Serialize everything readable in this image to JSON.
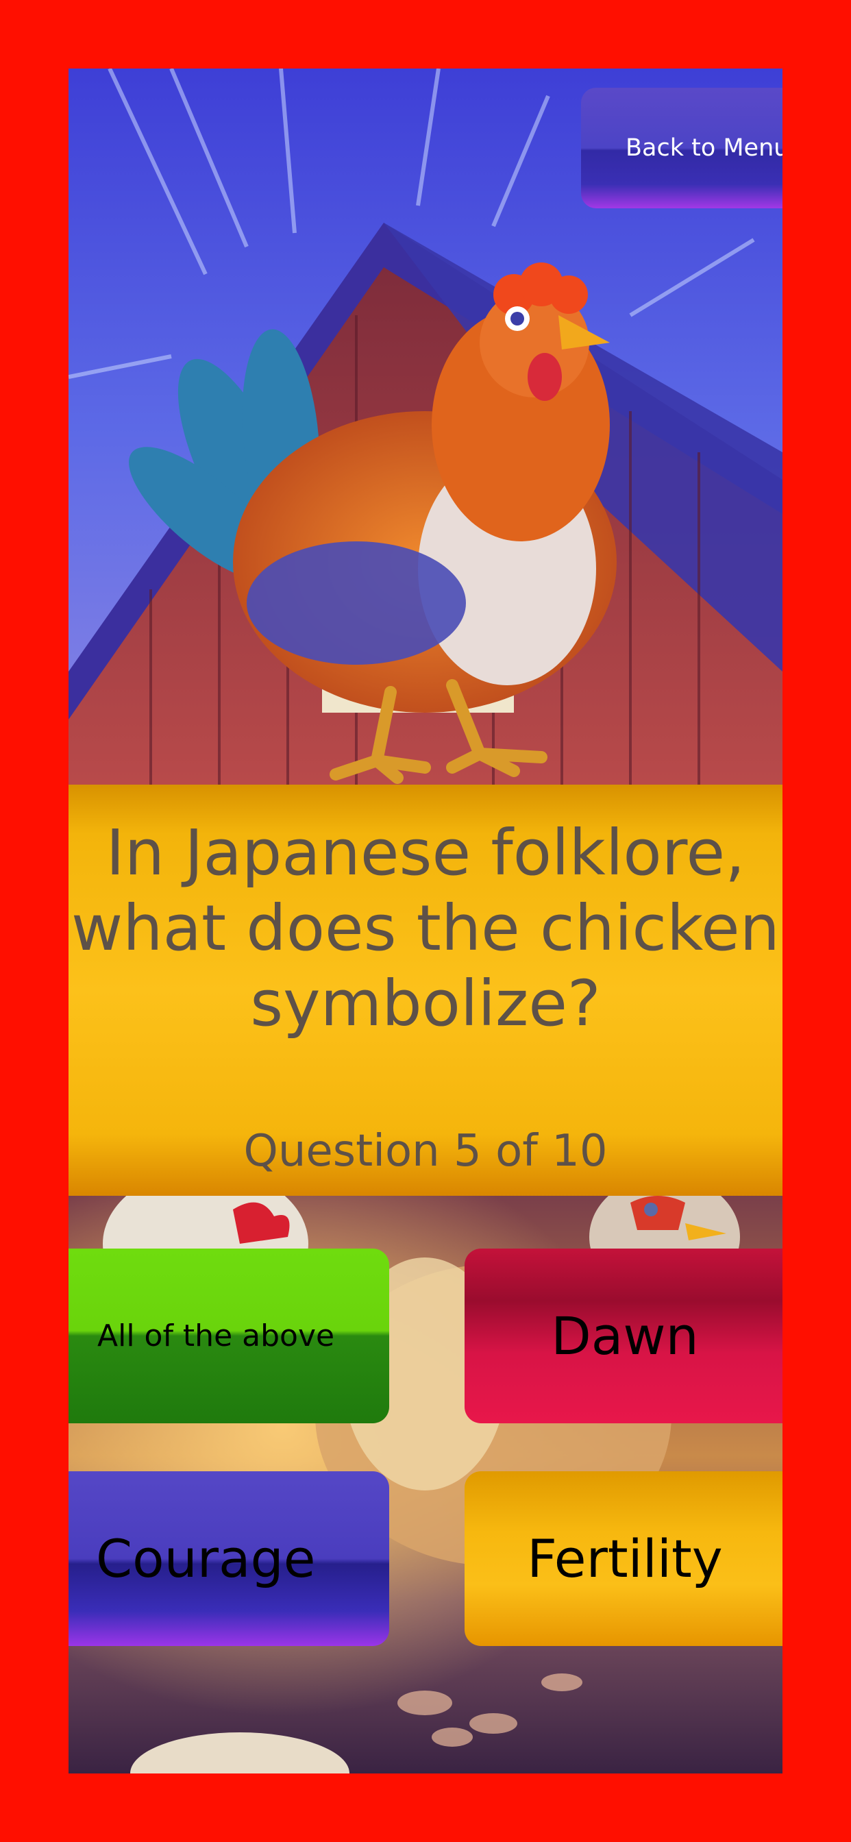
{
  "nav": {
    "back_label": "Back to Menu"
  },
  "question": {
    "text": "In Japanese folklore, what does the chicken symbolize?",
    "counter": "Question 5 of 10"
  },
  "answers": [
    {
      "label": "All of the above",
      "color": "#5fcb10"
    },
    {
      "label": "Dawn",
      "color": "#d4143f"
    },
    {
      "label": "Courage",
      "color": "#4438b8"
    },
    {
      "label": "Fertility",
      "color": "#f6b711"
    }
  ],
  "theme": {
    "frame_color": "#ff0f00",
    "question_panel_color": "#f9bd15",
    "question_text_color": "#5d5148"
  }
}
